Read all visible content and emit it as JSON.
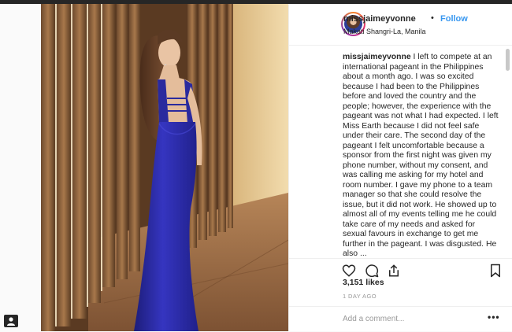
{
  "post": {
    "username": "missjaimeyvonne",
    "separator": "•",
    "follow_label": "Follow",
    "location": "Makati Shangri-La, Manila",
    "caption_user": "missjaimeyvonne",
    "caption_text": " I left to compete at an international pageant in the Philippines about a month ago. I was so excited because I had been to the Philippines before and loved the country and the people; however, the experience with the pageant was not what I had expected. I left Miss Earth because I did not feel safe under their care. The second day of the pageant I felt uncomfortable because a sponsor from the first night was given my phone number, without my consent, and was calling me asking for my hotel and room number. I gave my phone to a team manager so that she could resolve the issue, but it did not work. He showed up to almost all of my events telling me he could take care of my needs and asked for sexual favours in exchange to get me further in the pageant. I was disgusted. He also ..."
  },
  "actions": {
    "like_icon": "heart-icon",
    "comment_icon": "comment-icon",
    "share_icon": "share-icon",
    "save_icon": "bookmark-icon"
  },
  "likes_text": "3,151 likes",
  "timestamp": "1 DAY AGO",
  "comment": {
    "placeholder": "Add a comment...",
    "more_label": "•••"
  },
  "colors": {
    "follow": "#3897f0",
    "text": "#262626",
    "muted": "#999999",
    "gown": "#2a2a9e"
  }
}
